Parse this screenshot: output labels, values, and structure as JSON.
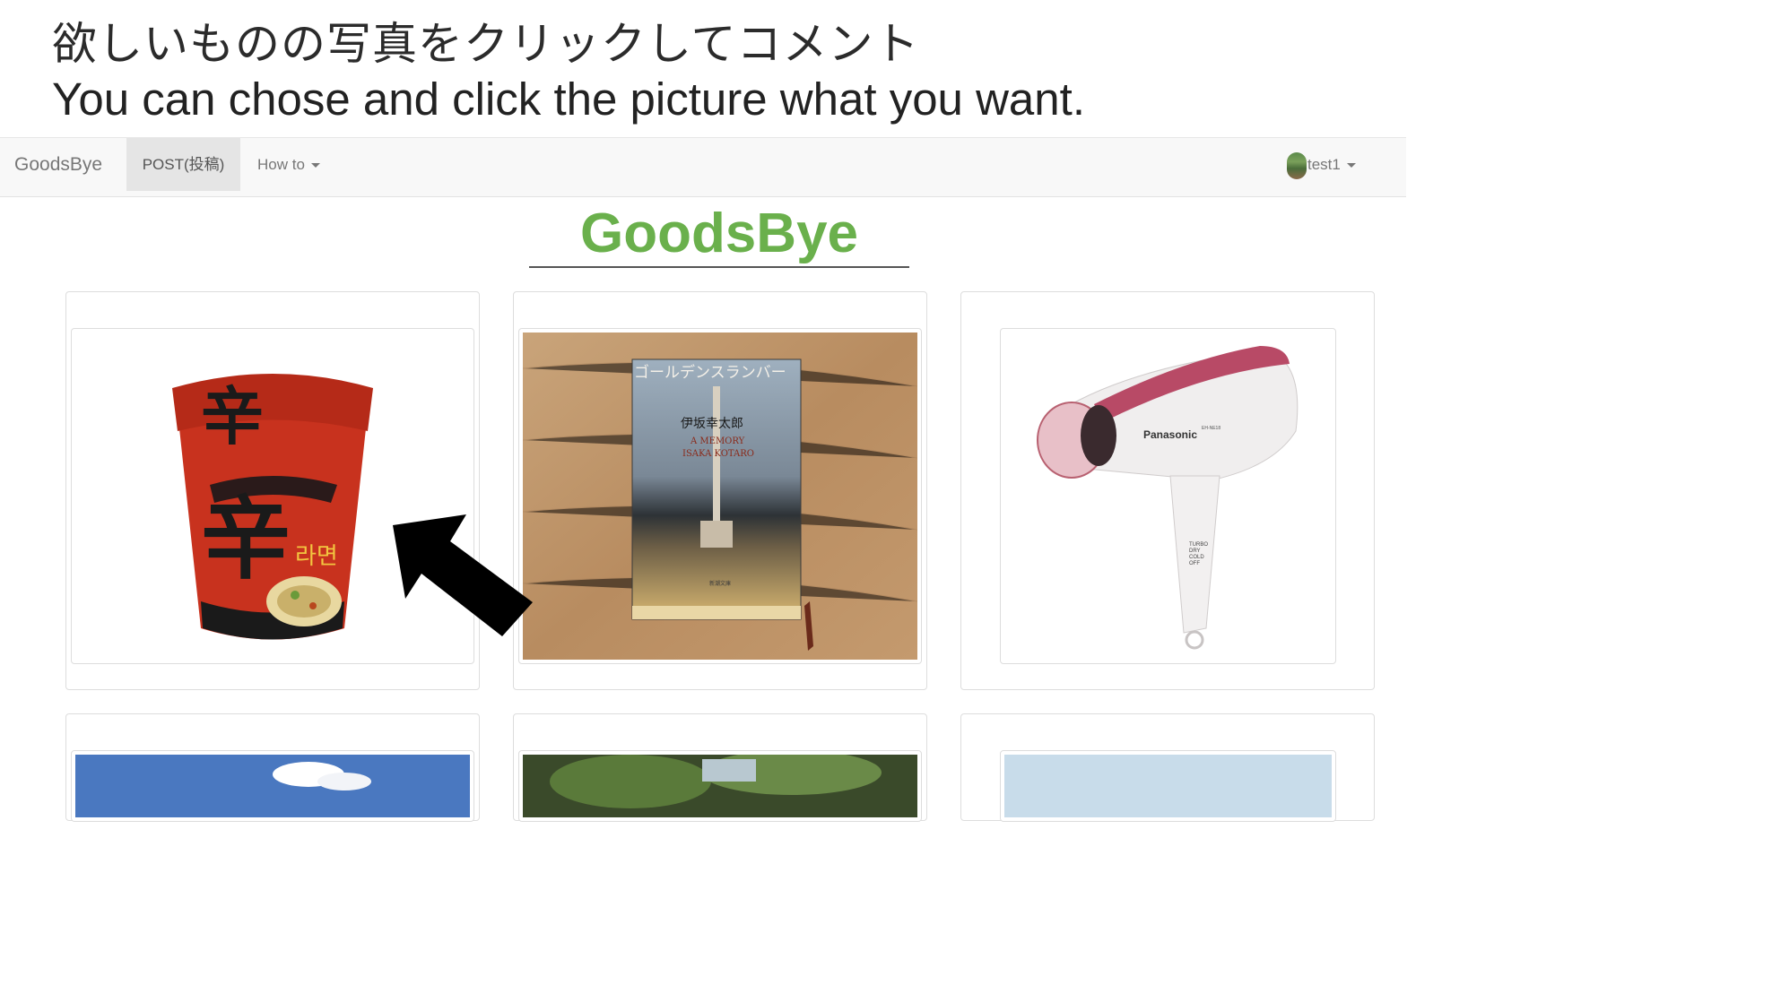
{
  "banner": {
    "instruction_jp": "欲しいものの写真をクリックしてコメント",
    "instruction_en": "You can chose and click the picture what you want."
  },
  "navbar": {
    "brand": "GoodsBye",
    "post_label": "POST(投稿)",
    "howto_label": "How to",
    "username": "test1",
    "icons": [
      "caret-down-icon",
      "avatar"
    ]
  },
  "main": {
    "title": "GoodsBye"
  },
  "items": [
    {
      "name": "ramen-cup",
      "book_title": "",
      "book_author": "",
      "book_subtitle": "",
      "book_author_en": ""
    },
    {
      "name": "book",
      "book_title": "ゴールデンスランバー",
      "book_author": "伊坂幸太郎",
      "book_subtitle": "A MEMORY",
      "book_author_en": "ISAKA KOTARO",
      "book_publisher": "新潮文庫"
    },
    {
      "name": "hair-dryer",
      "brand": "Panasonic",
      "model": "EH-NE18",
      "modes": [
        "TURBO",
        "DRY",
        "COLD",
        "OFF"
      ]
    }
  ],
  "colors": {
    "title_green": "#6ab04c",
    "navbar_bg": "#f8f8f8",
    "active_nav_bg": "#e5e5e5",
    "arrow": "#000000"
  }
}
